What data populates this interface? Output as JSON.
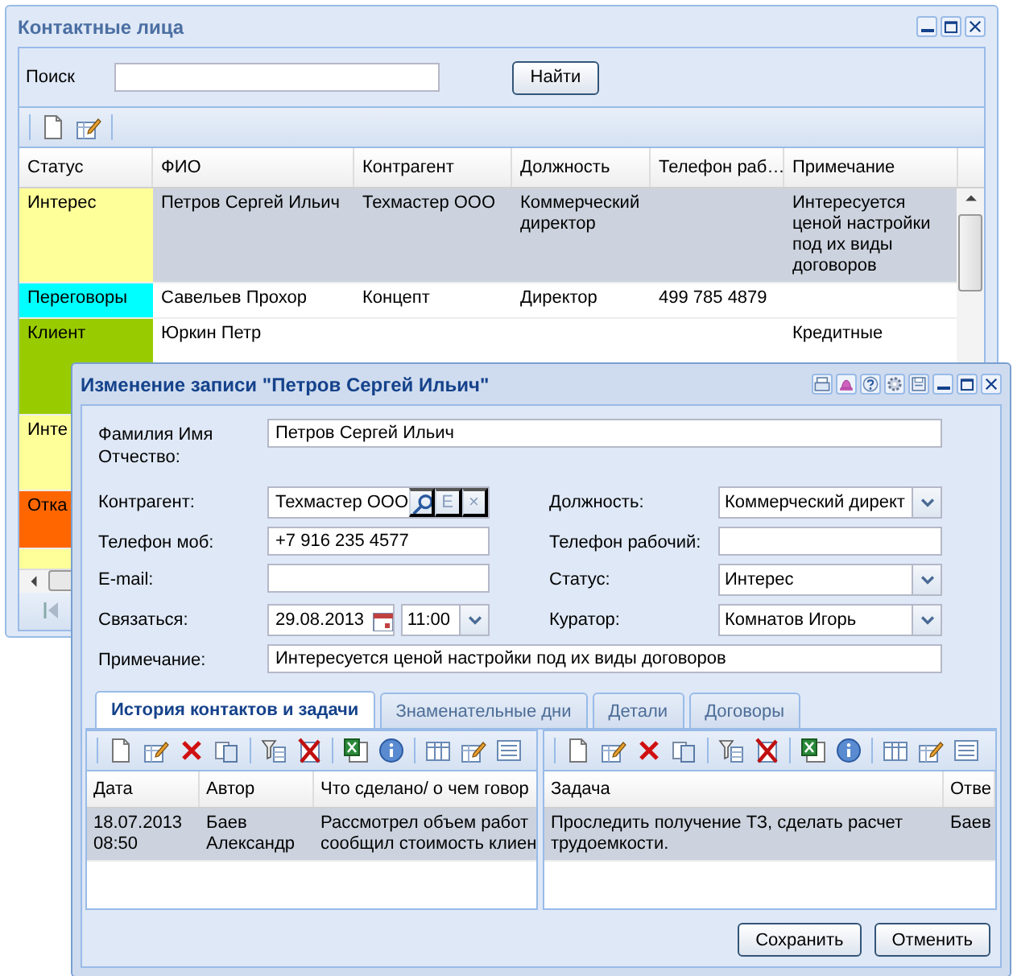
{
  "main_window": {
    "title": "Контактные лица",
    "search_label": "Поиск",
    "find_button": "Найти",
    "table": {
      "columns": [
        "Статус",
        "ФИО",
        "Контрагент",
        "Должность",
        "Телефон раб…",
        "Примечание"
      ],
      "rows": [
        {
          "status": "Интерес",
          "color": "#ffff99",
          "name": "Петров Сергей Ильич",
          "counterparty": "Техмастер ООО",
          "position": "Коммерческий директор",
          "note": "Интересуется ценой настройки под их виды договоров",
          "selected": true
        },
        {
          "status": "Переговоры",
          "color": "#00ffff",
          "name": "Савельев Прохор",
          "counterparty": "Концепт",
          "position": "Директор",
          "phone": "499 785 4879",
          "selected": false
        },
        {
          "status": "Клиент",
          "color": "#99cc00",
          "name": "Юркин Петр",
          "note": "Кредитные",
          "selected": false
        },
        {
          "status": "Инте",
          "color": "#ffff99"
        },
        {
          "status": "Отка",
          "color": "#ff6600"
        },
        {
          "color": "#ffff99"
        }
      ]
    }
  },
  "dialog": {
    "title": "Изменение записи \"Петров Сергей Ильич\"",
    "fields": [
      {
        "label": "Фамилия Имя Отчество:",
        "kind": "wide",
        "value": "Петров Сергей Ильич"
      },
      {
        "label": "Контрагент:",
        "kind": "lookup",
        "value": "Техмастер ООО",
        "edit_glyph": "E",
        "clear_glyph": "×"
      },
      {
        "label": "Должность:",
        "kind": "combo",
        "value": "Коммерческий директ"
      },
      {
        "label": "Телефон моб:",
        "kind": "text",
        "value": "+7 916 235 4577"
      },
      {
        "label": "Телефон рабочий:",
        "kind": "text"
      },
      {
        "label": "E-mail:",
        "kind": "text"
      },
      {
        "label": "Статус:",
        "kind": "combo",
        "value": "Интерес"
      },
      {
        "label": "Связаться:",
        "kind": "datetime",
        "date": "29.08.2013",
        "time": "11:00"
      },
      {
        "label": "Куратор:",
        "kind": "combo",
        "value": "Комнатов Игорь"
      },
      {
        "label": "Примечание:",
        "kind": "wide",
        "value": "Интересуется ценой настройки под их виды договоров"
      }
    ],
    "tabs": [
      {
        "label": "История контактов и задачи",
        "selected": true
      },
      {
        "label": "Знаменательные дни",
        "selected": false
      },
      {
        "label": "Детали",
        "selected": false
      },
      {
        "label": "Договоры",
        "selected": false
      }
    ],
    "history": {
      "columns": [
        "Дата",
        "Автор",
        "Что сделано/ о чем говор"
      ],
      "rows": [
        {
          "cells": [
            "18.07.2013\n08:50",
            "Баев\nАлександр",
            "Рассмотрел объем работ\nсообщил стоимость клиен"
          ],
          "selected": true
        }
      ]
    },
    "tasks": {
      "columns": [
        "Задача",
        "Отве"
      ],
      "rows": [
        {
          "cells": [
            "Проследить получение ТЗ, сделать расчет\nтрудоемкости.",
            "Баев"
          ],
          "selected": true
        }
      ]
    },
    "buttons": [
      "Сохранить",
      "Отменить"
    ]
  }
}
